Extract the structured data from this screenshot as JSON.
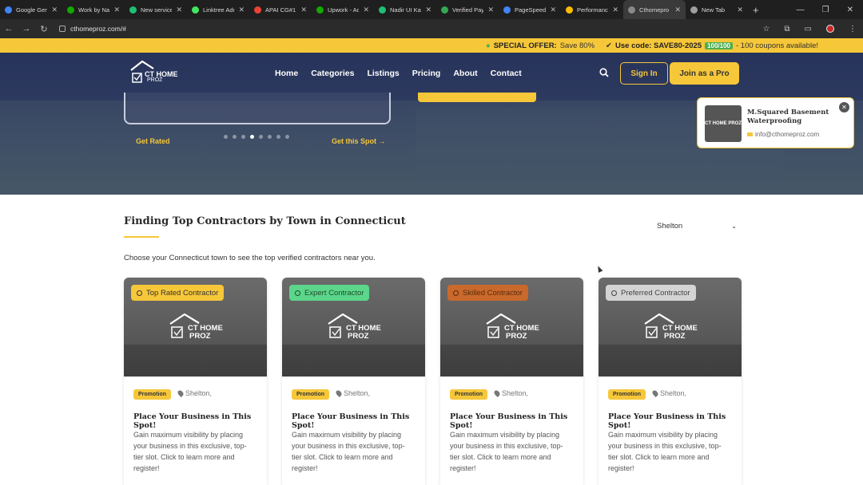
{
  "browser": {
    "tabs": [
      {
        "title": "Google Gem",
        "color": "#4285f4"
      },
      {
        "title": "Work by Na",
        "color": "#14a800"
      },
      {
        "title": "New service",
        "color": "#1dbf73"
      },
      {
        "title": "Linktree Adr",
        "color": "#43e660"
      },
      {
        "title": "APAI CG#1 -",
        "color": "#ea4335"
      },
      {
        "title": "Upwork - Ac",
        "color": "#14a800"
      },
      {
        "title": "Nadir UI Kay",
        "color": "#1dbf73"
      },
      {
        "title": "Verified Pay",
        "color": "#34a853"
      },
      {
        "title": "PageSpeed I",
        "color": "#4285f4"
      },
      {
        "title": "Performance",
        "color": "#fbbc05"
      },
      {
        "title": "Cthomepro",
        "color": "#888888"
      },
      {
        "title": "New Tab",
        "color": "#9e9e9e"
      }
    ],
    "active_tab": 10,
    "url": "cthomeproz.com/#"
  },
  "offer": {
    "special": "SPECIAL OFFER:",
    "save": "Save 80%",
    "code_label": "Use code: SAVE80-2025",
    "coupon_count": "100/100",
    "coupon_text": "- 100 coupons available!"
  },
  "header": {
    "logo_line1": "CT HOME",
    "logo_line2": "PROZ",
    "nav": [
      "Home",
      "Categories",
      "Listings",
      "Pricing",
      "About",
      "Contact"
    ],
    "sign_in": "Sign In",
    "join": "Join as a Pro"
  },
  "hero": {
    "get_rated": "Get Rated",
    "get_spot": "Get this Spot →",
    "dots_total": 8,
    "dots_active": 3
  },
  "popup": {
    "title": "M.Squared Basement Waterproofing",
    "email": "info@cthomeproz.com",
    "thumb": "CT HOME PROZ"
  },
  "section": {
    "title": "Finding Top Contractors by Town in Connecticut",
    "town": "Shelton",
    "description": "Choose your Connecticut town to see the top verified contractors near you."
  },
  "cards": [
    {
      "badge": "Top Rated Contractor",
      "badge_bg": "#f6c739",
      "badge_fg": "#333333",
      "promo": "Promotion",
      "location": "Shelton,",
      "title": "Place Your Business in This Spot!",
      "desc": "Gain maximum visibility by placing your business in this exclusive, top-tier slot. Click to learn more and register!",
      "logo1": "CT HOME",
      "logo2": "PROZ"
    },
    {
      "badge": "Expert Contractor",
      "badge_bg": "#5cd68a",
      "badge_fg": "#1d4d2c",
      "promo": "Promotion",
      "location": "Shelton,",
      "title": "Place Your Business in This Spot!",
      "desc": "Gain maximum visibility by placing your business in this exclusive, top-tier slot. Click to learn more and register!",
      "logo1": "CT HOME",
      "logo2": "PROZ"
    },
    {
      "badge": "Skilled Contractor",
      "badge_bg": "#c9692b",
      "badge_fg": "#5a2c10",
      "promo": "Promotion",
      "location": "Shelton,",
      "title": "Place Your Business in This Spot!",
      "desc": "Gain maximum visibility by placing your business in this exclusive, top-tier slot. Click to learn more and register!",
      "logo1": "CT HOME",
      "logo2": "PROZ"
    },
    {
      "badge": "Preferred Contractor",
      "badge_bg": "#d4d4d4",
      "badge_fg": "#444444",
      "promo": "Promotion",
      "location": "Shelton,",
      "title": "Place Your Business in This Spot!",
      "desc": "Gain maximum visibility by placing your business in this exclusive, top-tier slot. Click to learn more and register!",
      "logo1": "CT HOME",
      "logo2": "PROZ"
    }
  ]
}
